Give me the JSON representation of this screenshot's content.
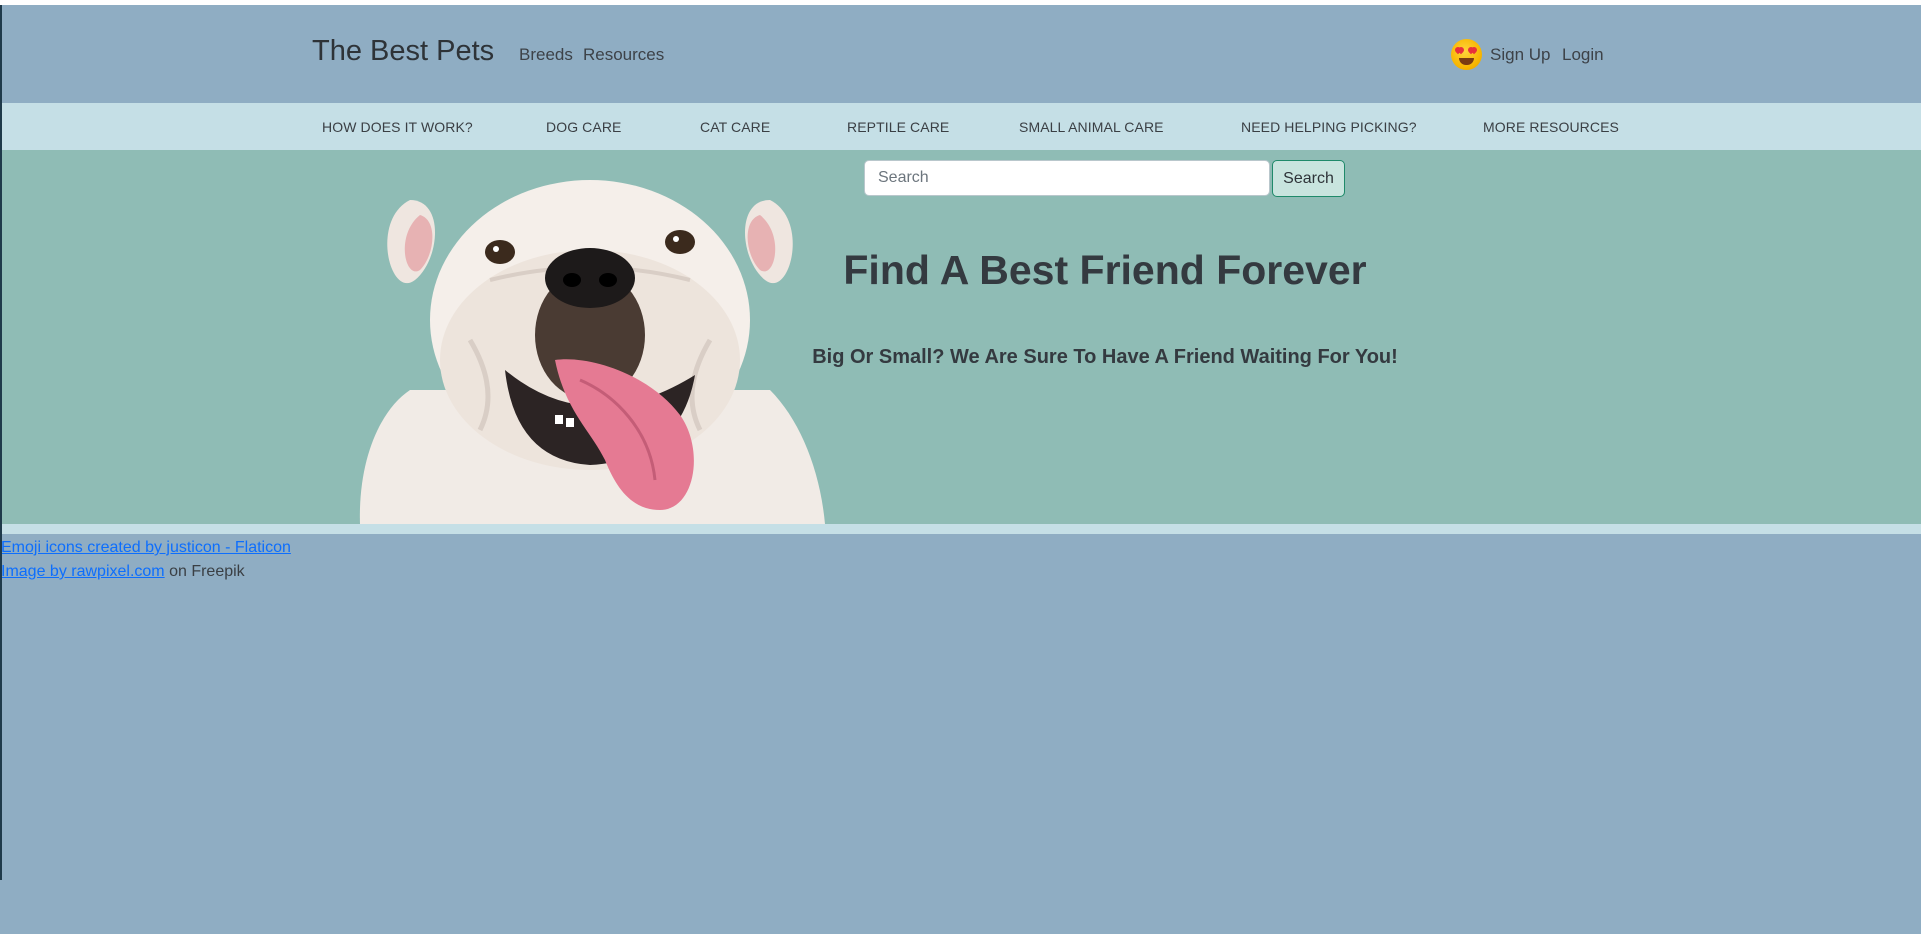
{
  "header": {
    "brand": "The Best Pets",
    "nav": [
      "Breeds",
      "Resources"
    ],
    "sign_up": "Sign Up",
    "login": "Login",
    "emoji_icon": "heart-eyes-emoji-icon"
  },
  "categories": [
    "HOW DOES IT WORK?",
    "DOG CARE",
    "CAT CARE",
    "REPTILE CARE",
    "SMALL ANIMAL CARE",
    "NEED HELPING PICKING?",
    "MORE RESOURCES"
  ],
  "hero": {
    "search_placeholder": "Search",
    "search_button": "Search",
    "title": "Find A Best Friend Forever",
    "subtitle": "Big Or Small? We Are Sure To Have A Friend Waiting For You!",
    "image": "white-bulldog-photo"
  },
  "credits": {
    "emoji_link": "Emoji icons created by justicon - Flaticon",
    "image_link": "Image by rawpixel.com",
    "image_suffix": " on Freepik"
  },
  "colors": {
    "header_bg": "#8fadc3",
    "category_bar_bg": "#c5dfe6",
    "hero_bg": "#8fbcb5",
    "search_button_border": "#1f8a6a",
    "link": "#0d6efd"
  }
}
